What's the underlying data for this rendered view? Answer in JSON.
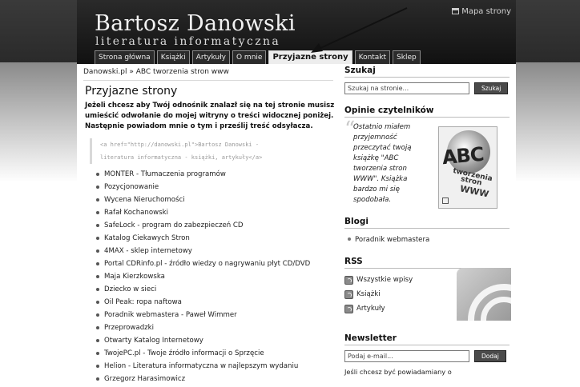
{
  "header": {
    "title": "Bartosz Danowski",
    "subtitle": "literatura informatyczna",
    "sitemap_label": "Mapa strony"
  },
  "nav": [
    {
      "label": "Strona główna",
      "active": false
    },
    {
      "label": "Książki",
      "active": false
    },
    {
      "label": "Artykuły",
      "active": false
    },
    {
      "label": "O mnie",
      "active": false
    },
    {
      "label": "Przyjazne strony",
      "active": true
    },
    {
      "label": "Kontakt",
      "active": false
    },
    {
      "label": "Sklep",
      "active": false
    }
  ],
  "breadcrumb": "Danowski.pl » ABC tworzenia stron www",
  "main": {
    "heading": "Przyjazne strony",
    "intro": "Jeżeli chcesz aby Twój odnośnik znalazł się na tej stronie musisz umieścić odwołanie do mojej witryny o treści widocznej poniżej. Następnie powiadom mnie o tym i prześlij treść odsyłacza.",
    "code_line1": "<a href=\"http://danowski.pl\">Bartosz Danowski -",
    "code_line2": "literatura informatyczna - książki, artykuły</a>",
    "links": [
      "MONTER - Tłumaczenia programów",
      "Pozycjonowanie",
      "Wycena Nieruchomości",
      "Rafał Kochanowski",
      "SafeLock - program do zabezpieczeń CD",
      "Katalog Ciekawych Stron",
      "4MAX - sklep internetowy",
      "Portal CDRinfo.pl - źródło wiedzy o nagrywaniu płyt CD/DVD",
      "Maja Kierzkowska",
      "Dziecko w sieci",
      "Oil Peak: ropa naftowa",
      "Poradnik webmastera - Paweł Wimmer",
      "Przeprowadzki",
      "Otwarty Katalog Internetowy",
      "TwojePC.pl - Twoje źródło informacji o Sprzęcie",
      "Helion - Literatura informatyczna w najlepszym wydaniu",
      "Grzegorz Harasimowicz"
    ]
  },
  "sidebar": {
    "search_heading": "Szukaj",
    "search_placeholder": "Szukaj na stronie...",
    "search_button": "Szukaj",
    "opinions_heading": "Opinie czytelników",
    "opinion_text": "Ostatnio miałem przyjemność przeczytać twoją książkę \"ABC tworzenia stron WWW\". Książka bardzo mi się spodobała.",
    "book_cover": {
      "big": "ABC",
      "line1": "tworzenia",
      "line2": "stron",
      "line3": "WWW"
    },
    "blogs_heading": "Blogi",
    "blog_item": "Poradnik webmastera",
    "rss_heading": "RSS",
    "rss_items": [
      "Wszystkie wpisy",
      "Książki",
      "Artykuły"
    ],
    "newsletter_heading": "Newsletter",
    "newsletter_placeholder": "Podaj e-mail...",
    "newsletter_button": "Dodaj",
    "newsletter_text": "Jeśli chcesz być powiadamiany o"
  }
}
